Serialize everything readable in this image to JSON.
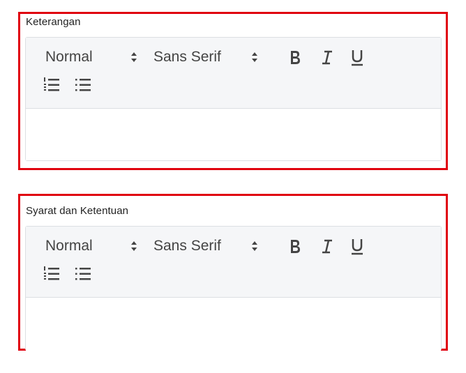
{
  "editors": [
    {
      "label": "Keterangan",
      "size_value": "Normal",
      "font_value": "Sans Serif"
    },
    {
      "label": "Syarat dan Ketentuan",
      "size_value": "Normal",
      "font_value": "Sans Serif"
    }
  ],
  "colors": {
    "highlight_border": "#e0000f",
    "toolbar_bg": "#f5f6f8",
    "icon": "#444444"
  },
  "icons": [
    "bold-icon",
    "italic-icon",
    "underline-icon",
    "ordered-list-icon",
    "bullet-list-icon",
    "up-down-arrows-icon"
  ]
}
